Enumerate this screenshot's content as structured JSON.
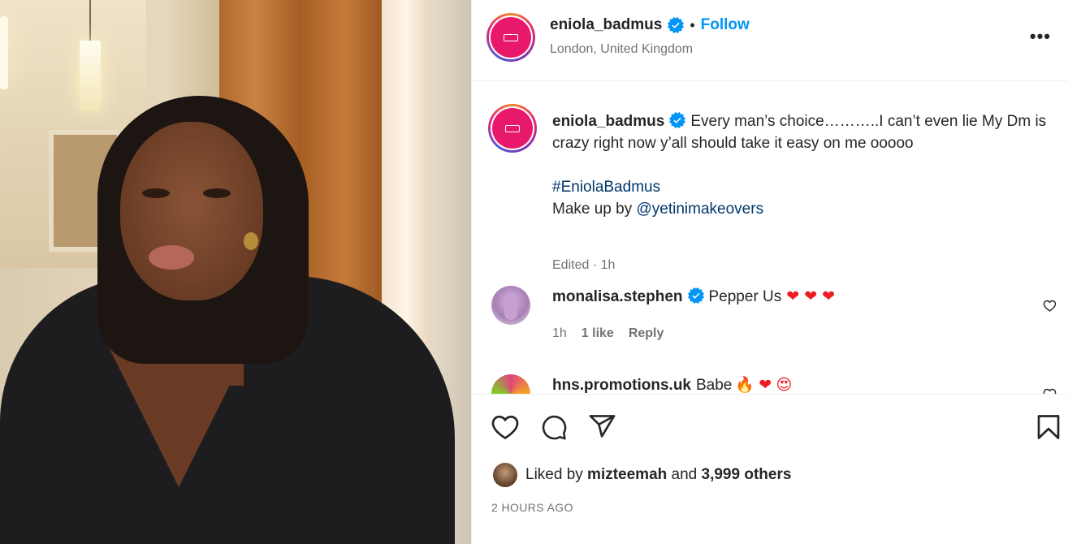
{
  "post": {
    "author": "eniola_badmus",
    "location": "London, United Kingdom",
    "follow_label": "Follow",
    "separator": "•",
    "more_label": "•••"
  },
  "caption": {
    "username": "eniola_badmus",
    "text": "Every man’s choice………..I can’t even lie My Dm is crazy right now y’all should take it easy on me ooooo",
    "hashtag": "#EniolaBadmus",
    "makeup_prefix": "Make up by ",
    "makeup_mention": "@yetinimakeovers",
    "meta": "Edited · 1h"
  },
  "comments": [
    {
      "username": "monalisa.stephen",
      "text": "Pepper Us",
      "emojis": "❤❤❤",
      "time": "1h",
      "likes": "1 like",
      "reply_label": "Reply"
    },
    {
      "username": "hns.promotions.uk",
      "text": "Babe",
      "emojis": "🔥 ❤ 😍"
    }
  ],
  "likes": {
    "prefix": "Liked by ",
    "user": "mizteemah",
    "middle": " and ",
    "others": "3,999 others"
  },
  "timestamp": "2 HOURS AGO",
  "icons": {
    "like": "heart-icon",
    "comment": "comment-icon",
    "share": "share-icon",
    "save": "bookmark-icon",
    "verified": "verified-badge-icon",
    "more": "more-options-icon"
  },
  "colors": {
    "link": "#0095f6",
    "hashtag": "#00376b",
    "secondary": "#737373",
    "verified": "#0095f6",
    "heart": "#ed1c24",
    "avatar_pink": "#e8196a"
  }
}
